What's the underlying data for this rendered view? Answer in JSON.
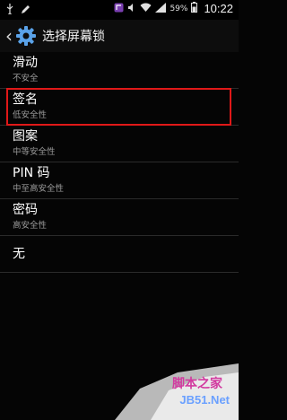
{
  "status_bar": {
    "battery": "59%",
    "time": "10:22"
  },
  "header": {
    "title": "选择屏幕锁"
  },
  "items": [
    {
      "title": "滑动",
      "subtitle": "不安全"
    },
    {
      "title": "签名",
      "subtitle": "低安全性"
    },
    {
      "title": "图案",
      "subtitle": "中等安全性"
    },
    {
      "title": "PIN 码",
      "subtitle": "中至高安全性"
    },
    {
      "title": "密码",
      "subtitle": "高安全性"
    },
    {
      "title": "无"
    }
  ],
  "watermark": {
    "line1": "脚本之家",
    "line2": "JB51.Net"
  },
  "colors": {
    "highlight": "#e01818",
    "background": "#050505",
    "subtitle": "#9a9a9a"
  }
}
